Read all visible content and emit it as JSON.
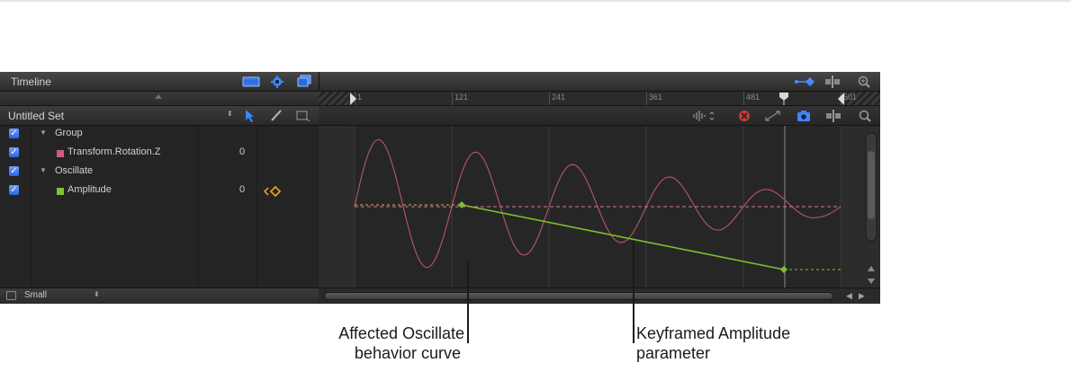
{
  "header": {
    "title": "Timeline"
  },
  "ruler": {
    "ticks": [
      "1",
      "121",
      "241",
      "361",
      "481",
      "601"
    ]
  },
  "set_name": "Untitled Set",
  "parameters": [
    {
      "label": "Group",
      "type": "group",
      "checked": true
    },
    {
      "label": "Transform.Rotation.Z",
      "type": "param",
      "color": "#d05a82",
      "value": "0",
      "checked": true
    },
    {
      "label": "Oscillate",
      "type": "group",
      "checked": true
    },
    {
      "label": "Amplitude",
      "type": "param",
      "color": "#7cc23a",
      "value": "0",
      "checked": true
    }
  ],
  "curve_colors": {
    "rotation": "#b85668",
    "rotation_dashed": "#d8789a",
    "amplitude": "#7fc02e"
  },
  "row_size": "Small",
  "callouts": {
    "left_line1": "Affected Oscillate",
    "left_line2": "behavior curve",
    "right_line1": "Keyframed Amplitude",
    "right_line2": "parameter"
  }
}
